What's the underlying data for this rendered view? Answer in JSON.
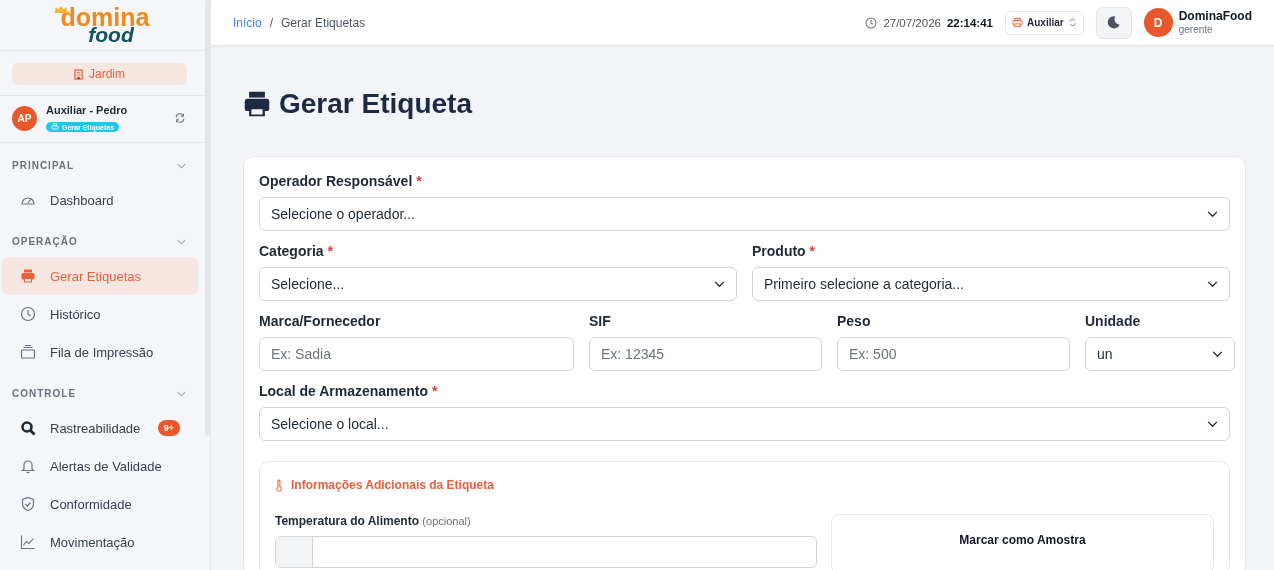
{
  "sidebar": {
    "logo": {
      "top": "domina",
      "bottom": "food"
    },
    "unit_button": "Jardim",
    "user": {
      "initials": "AP",
      "name": "Auxiliar - Pedro",
      "badge": "Gerar Etiquetas"
    },
    "sections": [
      {
        "title": "PRINCIPAL",
        "expanded": true,
        "items": [
          {
            "label": "Dashboard",
            "selected": false
          }
        ]
      },
      {
        "title": "OPERAÇÃO",
        "expanded": true,
        "items": [
          {
            "label": "Gerar Etiquetas",
            "selected": true
          },
          {
            "label": "Histórico",
            "selected": false
          },
          {
            "label": "Fila de Impressão",
            "selected": false
          }
        ]
      },
      {
        "title": "CONTROLE",
        "expanded": true,
        "items": [
          {
            "label": "Rastreabilidade",
            "selected": false,
            "badge": "9+"
          },
          {
            "label": "Alertas de Validade",
            "selected": false
          },
          {
            "label": "Conformidade",
            "selected": false
          },
          {
            "label": "Movimentação",
            "selected": false
          }
        ]
      }
    ]
  },
  "topbar": {
    "breadcrumb": [
      "Início",
      "Gerar Etiquetas"
    ],
    "separator": "/",
    "date": "27/07/2026",
    "time": "22:14:41",
    "role_button": "Auxiliar",
    "user": {
      "initial": "D",
      "name": "DominaFood",
      "role": "gerente"
    }
  },
  "page": {
    "title": "Gerar Etiqueta",
    "form_rows": [
      [
        {
          "kind": "select",
          "label": "Operador Responsável",
          "required_mark": "*",
          "value": "Selecione o operador..."
        }
      ],
      [
        {
          "kind": "select",
          "label": "Categoria",
          "required_mark": "*",
          "value": "Selecione..."
        },
        {
          "kind": "select",
          "label": "Produto",
          "required_mark": "*",
          "value": "Primeiro selecione a categoria..."
        }
      ],
      [
        {
          "kind": "input",
          "label": "Marca/Fornecedor",
          "placeholder": "Ex: Sadia"
        },
        {
          "kind": "input",
          "label": "SIF",
          "placeholder": "Ex: 12345"
        },
        {
          "kind": "input",
          "label": "Peso",
          "placeholder": "Ex: 500"
        },
        {
          "kind": "select",
          "label": "Unidade",
          "value": "un"
        }
      ],
      [
        {
          "kind": "select",
          "label": "Local de Armazenamento",
          "required_mark": "*",
          "value": "Selecione o local..."
        }
      ]
    ],
    "extra": {
      "title": "Informações Adicionais da Etiqueta",
      "temp_label": "Temperatura do Alimento",
      "temp_hint": "(opcional)",
      "sample_title": "Marcar como Amostra"
    }
  }
}
